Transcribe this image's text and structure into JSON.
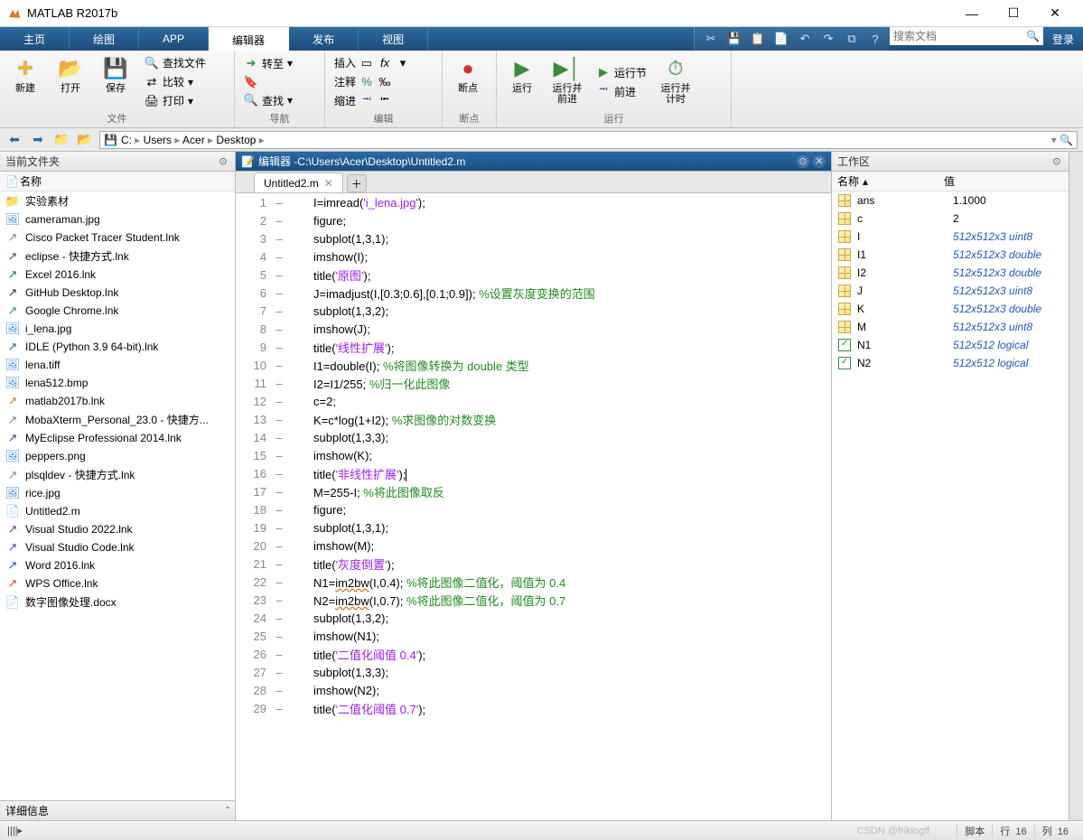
{
  "app": {
    "title": "MATLAB R2017b"
  },
  "window_controls": {
    "min": "—",
    "max": "☐",
    "close": "✕"
  },
  "maintabs": {
    "items": [
      "主页",
      "绘图",
      "APP",
      "编辑器",
      "发布",
      "视图"
    ],
    "active_index": 3
  },
  "quickaccess": {
    "icons": [
      "cut-icon",
      "save-icon",
      "separator",
      "copy-icon",
      "paste-icon",
      "undo-icon",
      "redo-icon",
      "switch-icon",
      "help-icon"
    ]
  },
  "search": {
    "placeholder": "搜索文档"
  },
  "login": {
    "label": "登录"
  },
  "ribbon": {
    "groups": {
      "file": {
        "label": "文件",
        "new": "新建",
        "open": "打开",
        "save": "保存",
        "find_files": "查找文件",
        "compare": "比较",
        "print": "打印"
      },
      "nav": {
        "label": "导航",
        "goto": "转至",
        "find": "查找",
        "bookmark": ""
      },
      "edit": {
        "label": "编辑",
        "insert": "插入",
        "comment": "注释",
        "indent": "缩进"
      },
      "breakpt": {
        "label": "断点",
        "breakpoints": "断点"
      },
      "run": {
        "label": "运行",
        "run": "运行",
        "run_advance": "运行并\n前进",
        "run_section": "运行节",
        "advance": "前进",
        "run_time": "运行并\n计时"
      }
    }
  },
  "path": {
    "drive_icon": "💾",
    "segments": [
      "C:",
      "Users",
      "Acer",
      "Desktop"
    ]
  },
  "left_panel": {
    "title": "当前文件夹",
    "col_name": "名称",
    "files": [
      {
        "name": "实验素材",
        "type": "folder",
        "color": "ico-folder"
      },
      {
        "name": "cameraman.jpg",
        "type": "img",
        "color": "ico-img"
      },
      {
        "name": "Cisco Packet Tracer Student.lnk",
        "type": "lnk",
        "color": "ico-lnk"
      },
      {
        "name": "eclipse - 快捷方式.lnk",
        "type": "lnk",
        "color": "ico-ecl"
      },
      {
        "name": "Excel 2016.lnk",
        "type": "lnk",
        "color": "ico-xl"
      },
      {
        "name": "GitHub Desktop.lnk",
        "type": "lnk",
        "color": "ico-gh"
      },
      {
        "name": "Google Chrome.lnk",
        "type": "lnk",
        "color": "ico-chrome"
      },
      {
        "name": "i_lena.jpg",
        "type": "img",
        "color": "ico-img"
      },
      {
        "name": "IDLE (Python 3.9 64-bit).lnk",
        "type": "lnk",
        "color": "ico-py"
      },
      {
        "name": "lena.tiff",
        "type": "img",
        "color": "ico-img"
      },
      {
        "name": "lena512.bmp",
        "type": "img",
        "color": "ico-img"
      },
      {
        "name": "matlab2017b.lnk",
        "type": "lnk",
        "color": "ico-mat"
      },
      {
        "name": "MobaXterm_Personal_23.0 - 快捷方...",
        "type": "lnk",
        "color": "ico-lnk"
      },
      {
        "name": "MyEclipse Professional 2014.lnk",
        "type": "lnk",
        "color": "ico-ecl"
      },
      {
        "name": "peppers.png",
        "type": "img",
        "color": "ico-img"
      },
      {
        "name": "plsqldev - 快捷方式.lnk",
        "type": "lnk",
        "color": "ico-lnk"
      },
      {
        "name": "rice.jpg",
        "type": "img",
        "color": "ico-img"
      },
      {
        "name": "Untitled2.m",
        "type": "m",
        "color": "ico-mat"
      },
      {
        "name": "Visual Studio 2022.lnk",
        "type": "lnk",
        "color": "ico-vs"
      },
      {
        "name": "Visual Studio Code.lnk",
        "type": "lnk",
        "color": "ico-vs"
      },
      {
        "name": "Word 2016.lnk",
        "type": "lnk",
        "color": "ico-doc"
      },
      {
        "name": "WPS Office.lnk",
        "type": "lnk",
        "color": "ico-wps"
      },
      {
        "name": "数字图像处理.docx",
        "type": "doc",
        "color": "ico-doc"
      }
    ],
    "details_label": "详细信息"
  },
  "editor": {
    "title_prefix": "编辑器 - ",
    "filepath": "C:\\Users\\Acer\\Desktop\\Untitled2.m",
    "tab_name": "Untitled2.m",
    "code": [
      {
        "n": 1,
        "t": [
          [
            "fn",
            "I=imread("
          ],
          [
            "str",
            "'i_lena.jpg'"
          ],
          [
            "fn",
            ");"
          ]
        ]
      },
      {
        "n": 2,
        "t": [
          [
            "fn",
            "figure;"
          ]
        ]
      },
      {
        "n": 3,
        "t": [
          [
            "fn",
            "subplot(1,3,1);"
          ]
        ]
      },
      {
        "n": 4,
        "t": [
          [
            "fn",
            "imshow(I);"
          ]
        ]
      },
      {
        "n": 5,
        "t": [
          [
            "fn",
            "title("
          ],
          [
            "str",
            "'原图'"
          ],
          [
            "fn",
            ");"
          ]
        ]
      },
      {
        "n": 6,
        "t": [
          [
            "fn",
            "J=imadjust(I,[0.3;0.6],[0.1;0.9]); "
          ],
          [
            "cmt",
            "%设置灰度变换的范围"
          ]
        ]
      },
      {
        "n": 7,
        "t": [
          [
            "fn",
            "subplot(1,3,2);"
          ]
        ]
      },
      {
        "n": 8,
        "t": [
          [
            "fn",
            "imshow(J);"
          ]
        ]
      },
      {
        "n": 9,
        "t": [
          [
            "fn",
            "title("
          ],
          [
            "str",
            "'线性扩展'"
          ],
          [
            "fn",
            ");"
          ]
        ]
      },
      {
        "n": 10,
        "t": [
          [
            "fn",
            "I1=double(I); "
          ],
          [
            "cmt",
            "%将图像转换为 double 类型"
          ]
        ]
      },
      {
        "n": 11,
        "t": [
          [
            "fn",
            "I2=I1/255; "
          ],
          [
            "cmt",
            "%归一化此图像"
          ]
        ]
      },
      {
        "n": 12,
        "t": [
          [
            "fn",
            "c=2;"
          ]
        ]
      },
      {
        "n": 13,
        "t": [
          [
            "fn",
            "K=c*log(1+I2); "
          ],
          [
            "cmt",
            "%求图像的对数变换"
          ]
        ]
      },
      {
        "n": 14,
        "t": [
          [
            "fn",
            "subplot(1,3,3);"
          ]
        ]
      },
      {
        "n": 15,
        "t": [
          [
            "fn",
            "imshow(K);"
          ]
        ]
      },
      {
        "n": 16,
        "t": [
          [
            "fn",
            "title("
          ],
          [
            "str",
            "'非线性扩展'"
          ],
          [
            "fn",
            ");"
          ]
        ],
        "cursor": true
      },
      {
        "n": 17,
        "t": [
          [
            "fn",
            "M=255-I; "
          ],
          [
            "cmt",
            "%将此图像取反"
          ]
        ]
      },
      {
        "n": 18,
        "t": [
          [
            "fn",
            "figure;"
          ]
        ]
      },
      {
        "n": 19,
        "t": [
          [
            "fn",
            "subplot(1,3,1);"
          ]
        ]
      },
      {
        "n": 20,
        "t": [
          [
            "fn",
            "imshow(M);"
          ]
        ]
      },
      {
        "n": 21,
        "t": [
          [
            "fn",
            "title("
          ],
          [
            "str",
            "'灰度倒置'"
          ],
          [
            "fn",
            ");"
          ]
        ]
      },
      {
        "n": 22,
        "t": [
          [
            "fn",
            "N1="
          ],
          [
            "uf",
            "im2bw"
          ],
          [
            "fn",
            "(I,0.4); "
          ],
          [
            "cmt",
            "%将此图像二值化，阈值为 0.4"
          ]
        ]
      },
      {
        "n": 23,
        "t": [
          [
            "fn",
            "N2="
          ],
          [
            "uf",
            "im2bw"
          ],
          [
            "fn",
            "(I,0.7); "
          ],
          [
            "cmt",
            "%将此图像二值化，阈值为 0.7"
          ]
        ]
      },
      {
        "n": 24,
        "t": [
          [
            "fn",
            "subplot(1,3,2);"
          ]
        ]
      },
      {
        "n": 25,
        "t": [
          [
            "fn",
            "imshow(N1);"
          ]
        ]
      },
      {
        "n": 26,
        "t": [
          [
            "fn",
            "title("
          ],
          [
            "str",
            "'二值化阈值 0.4'"
          ],
          [
            "fn",
            ");"
          ]
        ]
      },
      {
        "n": 27,
        "t": [
          [
            "fn",
            "subplot(1,3,3);"
          ]
        ]
      },
      {
        "n": 28,
        "t": [
          [
            "fn",
            "imshow(N2);"
          ]
        ]
      },
      {
        "n": 29,
        "t": [
          [
            "fn",
            "title("
          ],
          [
            "str",
            "'二值化阈值 0.7'"
          ],
          [
            "fn",
            ");"
          ]
        ]
      }
    ]
  },
  "workspace": {
    "title": "工作区",
    "col_name": "名称",
    "col_value": "值",
    "vars": [
      {
        "name": "ans",
        "value": "1.1000",
        "plain": true,
        "type": "num"
      },
      {
        "name": "c",
        "value": "2",
        "plain": true,
        "type": "num"
      },
      {
        "name": "I",
        "value": "512x512x3 uint8",
        "type": "num"
      },
      {
        "name": "I1",
        "value": "512x512x3 double",
        "type": "num"
      },
      {
        "name": "I2",
        "value": "512x512x3 double",
        "type": "num"
      },
      {
        "name": "J",
        "value": "512x512x3 uint8",
        "type": "num"
      },
      {
        "name": "K",
        "value": "512x512x3 double",
        "type": "num"
      },
      {
        "name": "M",
        "value": "512x512x3 uint8",
        "type": "num"
      },
      {
        "name": "N1",
        "value": "512x512 logical",
        "type": "logical"
      },
      {
        "name": "N2",
        "value": "512x512 logical",
        "type": "logical"
      }
    ]
  },
  "rightstrip": {
    "label": ""
  },
  "status": {
    "script": "脚本",
    "line_label": "行",
    "line": "16",
    "col_label": "列",
    "col": "16",
    "watermark": "CSDN @friklogff"
  }
}
